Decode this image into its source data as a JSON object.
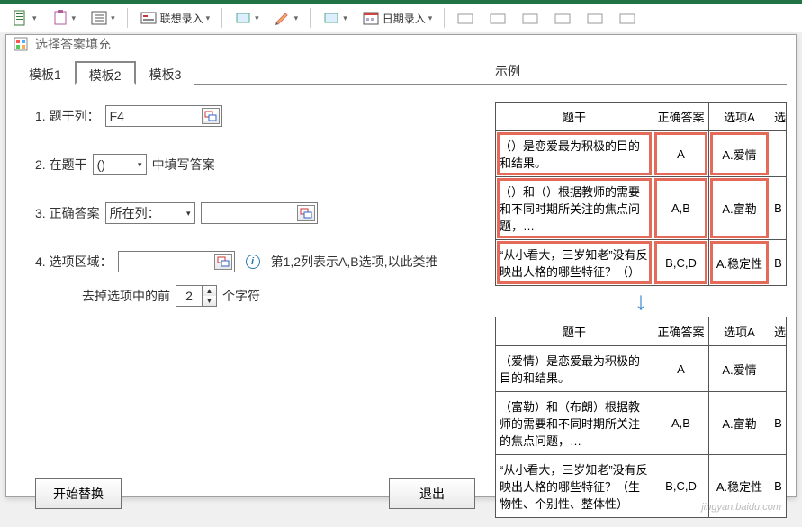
{
  "ribbon": {
    "assoc_label": "联想录入",
    "date_label": "日期录入"
  },
  "dialog": {
    "title": "选择答案填充"
  },
  "tabs": [
    "模板1",
    "模板2",
    "模板3"
  ],
  "active_tab": 1,
  "form": {
    "row1_label": "1. 题干列：",
    "row1_value": "F4",
    "row2_label": "2. 在题干",
    "row2_select": "()",
    "row2_suffix": "中填写答案",
    "row3_label": "3. 正确答案",
    "row3_select": "所在列：",
    "row3_value": "",
    "row4_label": "4. 选项区域：",
    "row4_value": "",
    "row4_hint": "第1,2列表示A,B选项,以此类推",
    "trim_prefix": "去掉选项中的前",
    "trim_value": "2",
    "trim_suffix": "个字符"
  },
  "buttons": {
    "start": "开始替换",
    "exit": "退出"
  },
  "example_label": "示例",
  "table_headers": {
    "q": "题干",
    "ans": "正确答案",
    "optA": "选项A",
    "optB": "选"
  },
  "table_before": [
    {
      "q": "（）是恋爱最为积极的目的和结果。",
      "ans": "A",
      "optA": "A.爱情",
      "optB": ""
    },
    {
      "q": "（）和（）根据教师的需要和不同时期所关注的焦点问题，…",
      "ans": "A,B",
      "optA": "A.富勒",
      "optB": "B"
    },
    {
      "q": "“从小看大，三岁知老”没有反映出人格的哪些特征？（）",
      "ans": "B,C,D",
      "optA": "A.稳定性",
      "optB": "B"
    }
  ],
  "table_after": [
    {
      "q": "（爱情）是恋爱最为积极的目的和结果。",
      "ans": "A",
      "optA": "A.爱情",
      "optB": ""
    },
    {
      "q": "（富勒）和（布朗）根据教师的需要和不同时期所关注的焦点问题，…",
      "ans": "A,B",
      "optA": "A.富勒",
      "optB": "B"
    },
    {
      "q": "“从小看大，三岁知老”没有反映出人格的哪些特征？（生物性、个别性、整体性）",
      "ans": "B,C,D",
      "optA": "A.稳定性",
      "optB": "B"
    }
  ],
  "watermark": "jingyan.baidu.com"
}
